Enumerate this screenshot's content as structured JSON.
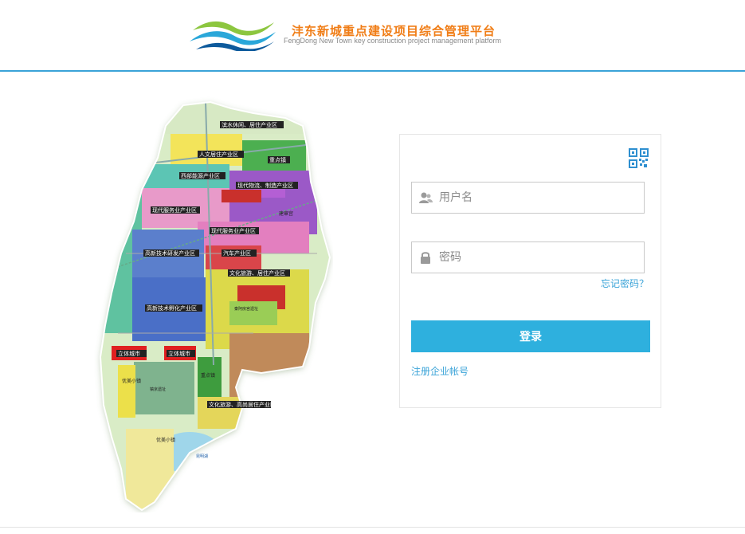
{
  "header": {
    "title": "沣东新城重点建设项目综合管理平台",
    "subtitle": "FengDong New Town key construction project management platform"
  },
  "map": {
    "labels": {
      "l1": "滨水休闲、居住产业区",
      "l2": "人文居住产业区",
      "l3": "重点镇",
      "l4": "西部能源产业区",
      "l5": "现代物流、制造产业区",
      "l6": "现代服务业产业区",
      "l7": "建章宫",
      "l8": "现代服务业产业区",
      "l9": "高新技术研发产业区",
      "l10": "汽车产业区",
      "l11": "文化旅游、居住产业区",
      "l12": "秦阿房宫遗址",
      "l13": "高新技术孵化产业区",
      "l14": "立体城市",
      "l15": "立体城市",
      "l16": "优美小镇",
      "l17": "镐京遗址",
      "l18": "重点镇",
      "l19": "文化旅游、高尚居住产业区",
      "l20": "优美小镇",
      "l21": "昆明湖"
    }
  },
  "login": {
    "username_placeholder": "用户名",
    "password_placeholder": "密码",
    "forgot_label": "忘记密码？",
    "submit_label": "登录",
    "register_label": "注册企业帐号"
  },
  "colors": {
    "accent": "#2eb0de",
    "brand": "#f07d16",
    "header_border": "#3aa3d8"
  }
}
